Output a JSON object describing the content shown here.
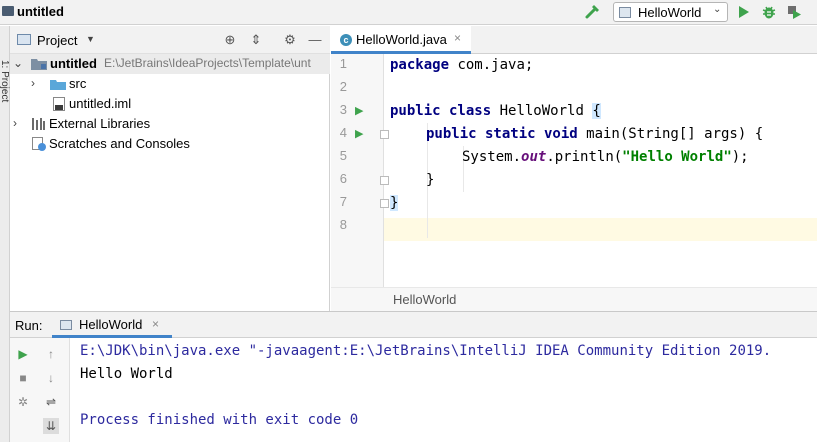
{
  "topbar": {
    "project_title": "untitled",
    "run_config": "HelloWorld"
  },
  "left_stripe": {
    "label": "1: Project"
  },
  "project_panel": {
    "header_label": "Project",
    "tree": [
      {
        "label": "untitled",
        "path": "E:\\JetBrains\\IdeaProjects\\Template\\unt"
      },
      {
        "label": "src"
      },
      {
        "label": "untitled.iml"
      },
      {
        "label": "External Libraries"
      },
      {
        "label": "Scratches and Consoles"
      }
    ]
  },
  "editor": {
    "tab_label": "HelloWorld.java",
    "breadcrumb": "HelloWorld",
    "line_numbers": [
      "1",
      "2",
      "3",
      "4",
      "5",
      "6",
      "7",
      "8"
    ],
    "code": {
      "l1_kw": "package",
      "l1_rest": " com.java;",
      "l3_kw": "public class",
      "l3_rest": " HelloWorld ",
      "l3_brace": "{",
      "l4_kw": "public static void",
      "l4_rest": " main(String[] args) {",
      "l5_a": "System.",
      "l5_field": "out",
      "l5_b": ".println(",
      "l5_str": "\"Hello World\"",
      "l5_c": ");",
      "l6": "}",
      "l7": "}"
    }
  },
  "run_panel": {
    "label": "Run:",
    "tab_label": "HelloWorld",
    "console": {
      "command": "E:\\JDK\\bin\\java.exe \"-javaagent:E:\\JetBrains\\IntelliJ IDEA Community Edition 2019.",
      "output": "Hello World",
      "exit": "Process finished with exit code 0"
    }
  },
  "colors": {
    "keyword": "#000080",
    "string": "#008000",
    "field": "#660e7a",
    "run_green": "#3fa34d",
    "accent_blue": "#4083c9"
  },
  "icons": [
    "folder-icon",
    "hammer-icon",
    "run-icon",
    "debug-icon",
    "coverage-icon",
    "target-icon",
    "collapse-icon",
    "gear-icon",
    "minimize-icon"
  ]
}
